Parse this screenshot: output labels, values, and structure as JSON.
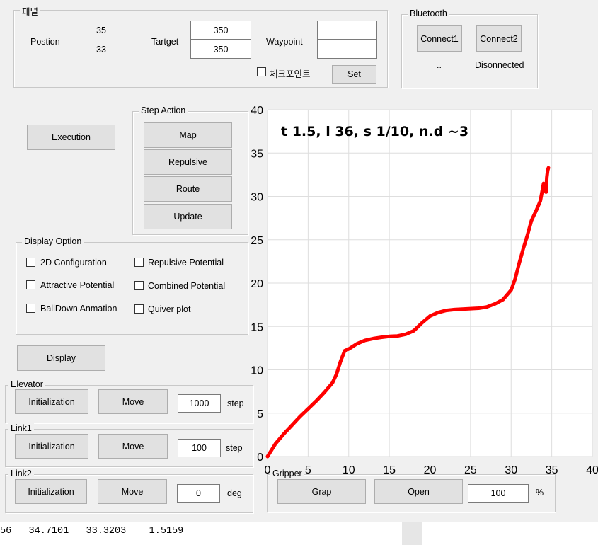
{
  "panel": {
    "title": "패널",
    "position_label": "Postion",
    "position_x": "35",
    "position_y": "33",
    "target_label": "Tartget",
    "target_x": "350",
    "target_y": "350",
    "waypoint_label": "Waypoint",
    "waypoint_1": "",
    "waypoint_2": "",
    "checkpoint_label": "체크포인트",
    "checkpoint_checked": false,
    "set_label": "Set"
  },
  "bluetooth": {
    "title": "Bluetooth",
    "connect1_label": "Connect1",
    "connect2_label": "Connect2",
    "status_1": "..",
    "status_2": "Disonnected"
  },
  "execution_label": "Execution",
  "step_action": {
    "title": "Step Action",
    "buttons": [
      "Map",
      "Repulsive",
      "Route",
      "Update"
    ]
  },
  "display_option": {
    "title": "Display Option",
    "options": [
      {
        "label": "2D Configuration",
        "checked": false
      },
      {
        "label": "Repulsive Potential",
        "checked": false
      },
      {
        "label": "Attractive Potential",
        "checked": false
      },
      {
        "label": "Combined Potential",
        "checked": false
      },
      {
        "label": "BallDown Anmation",
        "checked": false
      },
      {
        "label": "Quiver plot",
        "checked": false
      }
    ]
  },
  "display_label": "Display",
  "elevator": {
    "title": "Elevator",
    "init_label": "Initialization",
    "move_label": "Move",
    "value": "1000",
    "unit": "step"
  },
  "link1": {
    "title": "Link1",
    "init_label": "Initialization",
    "move_label": "Move",
    "value": "100",
    "unit": "step"
  },
  "link2": {
    "title": "Link2",
    "init_label": "Initialization",
    "move_label": "Move",
    "value": "0",
    "unit": "deg"
  },
  "gripper": {
    "title": "Gripper",
    "grap_label": "Grap",
    "open_label": "Open",
    "value": "100",
    "unit": "%"
  },
  "command_window": {
    "text": "56   34.7101   33.3203    1.5159"
  },
  "colors": {
    "line": "#ff0000",
    "background": "#f0f0f0",
    "axes_bg": "#ffffff",
    "grid": "#dedede"
  },
  "chart_data": {
    "type": "line",
    "title": "t 1.5, l 36, s 1/10, n.d ~3",
    "xlabel": "",
    "ylabel": "",
    "xlim": [
      0,
      40
    ],
    "ylim": [
      0,
      40
    ],
    "xticks": [
      "0",
      "5",
      "10",
      "15",
      "20",
      "25",
      "30",
      "35",
      "40"
    ],
    "yticks": [
      "0",
      "5",
      "10",
      "15",
      "20",
      "25",
      "30",
      "35",
      "40"
    ],
    "grid": true,
    "series": [
      {
        "x": [
          0,
          1,
          2,
          3,
          4,
          5,
          6,
          7,
          8,
          8.5,
          9,
          9.5,
          10,
          11,
          12,
          13,
          14,
          15,
          16,
          17,
          18,
          19,
          20,
          21,
          22,
          23,
          24,
          25,
          26,
          27,
          28,
          29,
          30,
          30.5,
          31,
          31.5,
          32,
          32.5,
          33,
          33.2,
          33.6,
          34,
          34.3,
          34.4,
          34.5,
          34.6
        ],
        "y": [
          0,
          1.5,
          2.6,
          3.6,
          4.6,
          5.5,
          6.4,
          7.4,
          8.5,
          9.5,
          11,
          12.2,
          12.4,
          13,
          13.4,
          13.6,
          13.75,
          13.85,
          13.9,
          14.1,
          14.5,
          15.4,
          16.2,
          16.6,
          16.85,
          16.95,
          17.0,
          17.05,
          17.1,
          17.25,
          17.6,
          18.1,
          19.2,
          20.5,
          22.3,
          24.0,
          25.5,
          27.2,
          28.2,
          28.6,
          29.5,
          31.5,
          30.5,
          32.2,
          33.0,
          33.3
        ]
      }
    ]
  }
}
